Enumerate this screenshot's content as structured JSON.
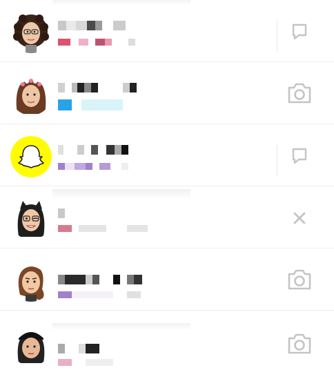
{
  "conversations": [
    {
      "name": "",
      "status": "",
      "avatar": "curly-dark-hair-bitmoji",
      "action": "chat-bubble-icon",
      "status_color": "#e0506a"
    },
    {
      "name": "",
      "status": "",
      "avatar": "flower-crown-bitmoji",
      "action": "camera-icon",
      "status_color": "#2aa2e8"
    },
    {
      "name": "",
      "status": "",
      "avatar": "snapchat-ghost-logo",
      "action": "chat-bubble-icon",
      "status_color": "#a082c8"
    },
    {
      "name": "",
      "status": "",
      "avatar": "winking-cat-ears-bitmoji",
      "action": "close-icon",
      "status_color": "#d87a8a"
    },
    {
      "name": "",
      "status": "",
      "avatar": "brown-hair-bitmoji",
      "action": "camera-icon",
      "status_color": "#a082c8"
    },
    {
      "name": "",
      "status": "",
      "avatar": "black-cap-bitmoji",
      "action": "camera-icon",
      "status_color": "#e8b0c0"
    }
  ],
  "colors": {
    "snap_yellow": "#fffc00",
    "icon_gray": "#c4c4c4",
    "divider": "#f0f0f0"
  }
}
